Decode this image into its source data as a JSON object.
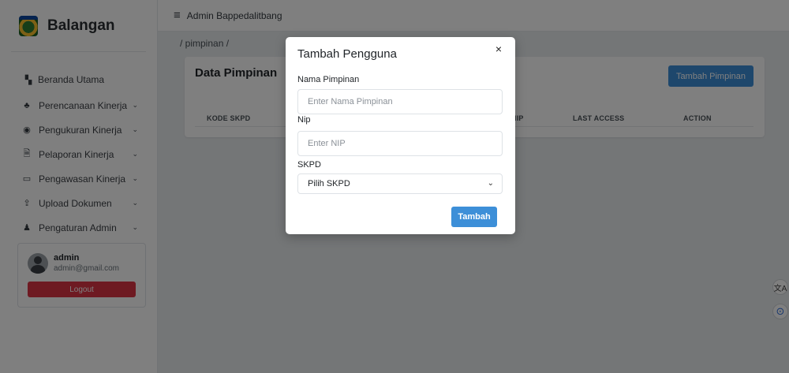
{
  "sidebar": {
    "brand": "Balangan",
    "items": [
      {
        "label": "Beranda Utama",
        "icon": "dashboard-icon",
        "glyph": "▚",
        "chevron": false
      },
      {
        "label": "Perencanaan Kinerja",
        "icon": "sitemap-icon",
        "glyph": "♣",
        "chevron": true
      },
      {
        "label": "Pengukuran Kinerja",
        "icon": "gauge-icon",
        "glyph": "◉",
        "chevron": true
      },
      {
        "label": "Pelaporan Kinerja",
        "icon": "report-icon",
        "glyph": "🗎",
        "chevron": true
      },
      {
        "label": "Pengawasan Kinerja",
        "icon": "monitor-icon",
        "glyph": "▭",
        "chevron": true
      },
      {
        "label": "Upload Dokumen",
        "icon": "upload-icon",
        "glyph": "⇪",
        "chevron": true
      },
      {
        "label": "Pengaturan Admin",
        "icon": "users-cog-icon",
        "glyph": "♟",
        "chevron": true
      }
    ],
    "user": {
      "name": "admin",
      "email": "admin@gmail.com",
      "logout_label": "Logout"
    }
  },
  "topbar": {
    "title": "Admin Bappedalitbang"
  },
  "breadcrumb": "/ pimpinan /",
  "main": {
    "card_title": "Data Pimpinan",
    "add_button": "Tambah Pimpinan",
    "columns": [
      "KODE SKPD",
      "NIP",
      "LAST ACCESS",
      "ACTION"
    ]
  },
  "modal": {
    "title": "Tambah Pengguna",
    "close_glyph": "×",
    "fields": {
      "nama": {
        "label": "Nama Pimpinan",
        "placeholder": "Enter Nama Pimpinan",
        "value": ""
      },
      "nip": {
        "label": "Nip",
        "placeholder": "Enter NIP",
        "value": ""
      },
      "skpd": {
        "label": "SKPD",
        "selected": "Pilih SKPD"
      }
    },
    "submit_label": "Tambah"
  },
  "floating": {
    "translate_glyph": "文A",
    "assistant_glyph": "⊙"
  },
  "colors": {
    "primary": "#3d8fd8",
    "danger": "#dc3545",
    "overlay": "rgba(0,0,0,0.5)"
  }
}
